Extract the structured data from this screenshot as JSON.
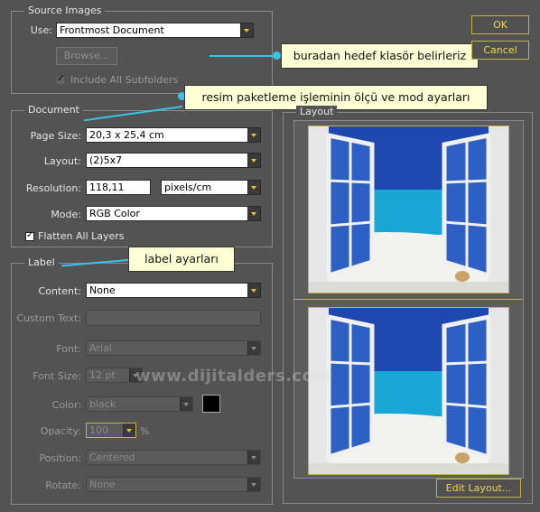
{
  "source_images": {
    "title": "Source Images",
    "use_label": "Use:",
    "use_value": "Frontmost Document",
    "browse_label": "Browse...",
    "include_subfolders_label": "Include All Subfolders"
  },
  "document": {
    "title": "Document",
    "page_size_label": "Page Size:",
    "page_size_value": "20,3 x 25,4 cm",
    "layout_label": "Layout:",
    "layout_value": "(2)5x7",
    "resolution_label": "Resolution:",
    "resolution_value": "118,11",
    "resolution_unit": "pixels/cm",
    "mode_label": "Mode:",
    "mode_value": "RGB Color",
    "flatten_label": "Flatten All Layers"
  },
  "label_section": {
    "title": "Label",
    "content_label": "Content:",
    "content_value": "None",
    "custom_text_label": "Custom Text:",
    "custom_text_value": "",
    "font_label": "Font:",
    "font_value": "Arial",
    "font_size_label": "Font Size:",
    "font_size_value": "12 pt",
    "color_label": "Color:",
    "color_value": "black",
    "opacity_label": "Opacity:",
    "opacity_value": "100",
    "opacity_unit": "%",
    "position_label": "Position:",
    "position_value": "Centered",
    "rotate_label": "Rotate:",
    "rotate_value": "None"
  },
  "layout_panel": {
    "title": "Layout"
  },
  "buttons": {
    "ok": "OK",
    "cancel": "Cancel",
    "edit_layout": "Edit Layout..."
  },
  "callouts": {
    "source": "buradan hedef klasör belirleriz",
    "document": "resim paketleme işleminin ölçü ve mod ayarları",
    "label": "label ayarları"
  },
  "watermark": "www.dijitalders.com",
  "colors": {
    "accent": "#e8c232",
    "callout_bg": "#ffffd6",
    "arrow": "#38c4e8",
    "sky": "#1a4db8"
  }
}
